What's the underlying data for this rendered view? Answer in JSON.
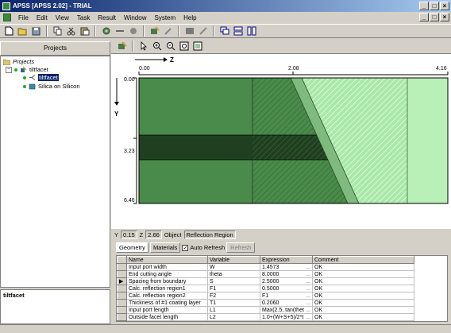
{
  "window": {
    "title": "APSS [APSS 2.02] - TRIAL",
    "min": "_",
    "max": "□",
    "close": "×"
  },
  "menu": [
    "File",
    "Edit",
    "View",
    "Task",
    "Result",
    "Window",
    "System",
    "Help"
  ],
  "projects_panel": {
    "title": "Projects"
  },
  "tree": {
    "root": "Projects",
    "project": "tiltfacet",
    "child_selected": "tiltfacet",
    "child_other": "Silica on Silicon"
  },
  "description": "tiltfacet",
  "canvas": {
    "z_axis_label": "Z",
    "y_axis_label": "Y",
    "z_ticks": [
      "0.00",
      "2.08",
      "4.16"
    ],
    "y_ticks": [
      "0.00",
      "3.23",
      "6.46"
    ]
  },
  "status": {
    "y_label": "Y",
    "y_value": "0.15",
    "z_label": "Z",
    "z_value": "2.66",
    "object_label": "Object",
    "object_value": "Reflection Region"
  },
  "tabs": {
    "geometry": "Geometry",
    "materials": "Materials",
    "auto_refresh": "Auto Refresh",
    "refresh": "Refresh"
  },
  "table": {
    "headers": [
      "Name",
      "Variable",
      "Expression",
      "Comment"
    ],
    "rows": [
      {
        "name": "Input port width",
        "variable": "W",
        "expression": "1.4573",
        "comment": "OK"
      },
      {
        "name": "End cutting angle",
        "variable": "theta",
        "expression": "8.0000",
        "comment": "OK"
      },
      {
        "name": "Spacing from boundary",
        "variable": "S",
        "expression": "2.5000",
        "comment": "OK"
      },
      {
        "name": "Calc. reflection region1",
        "variable": "F1",
        "expression": "0.5000",
        "comment": "OK"
      },
      {
        "name": "Calc. reflection region2",
        "variable": "F2",
        "expression": "F1",
        "comment": "OK"
      },
      {
        "name": "Thickness of #1 coating layer",
        "variable": "T1",
        "expression": "0.2060",
        "comment": "OK"
      },
      {
        "name": "Input port length",
        "variable": "L1",
        "expression": "Max(2.5, tan(thet",
        "comment": "OK"
      },
      {
        "name": "Outside facet length",
        "variable": "L2",
        "expression": "1.0+(W+S+5)/2*t",
        "comment": "OK"
      }
    ],
    "current_row_marker": "▶",
    "ellipsis": "..."
  }
}
